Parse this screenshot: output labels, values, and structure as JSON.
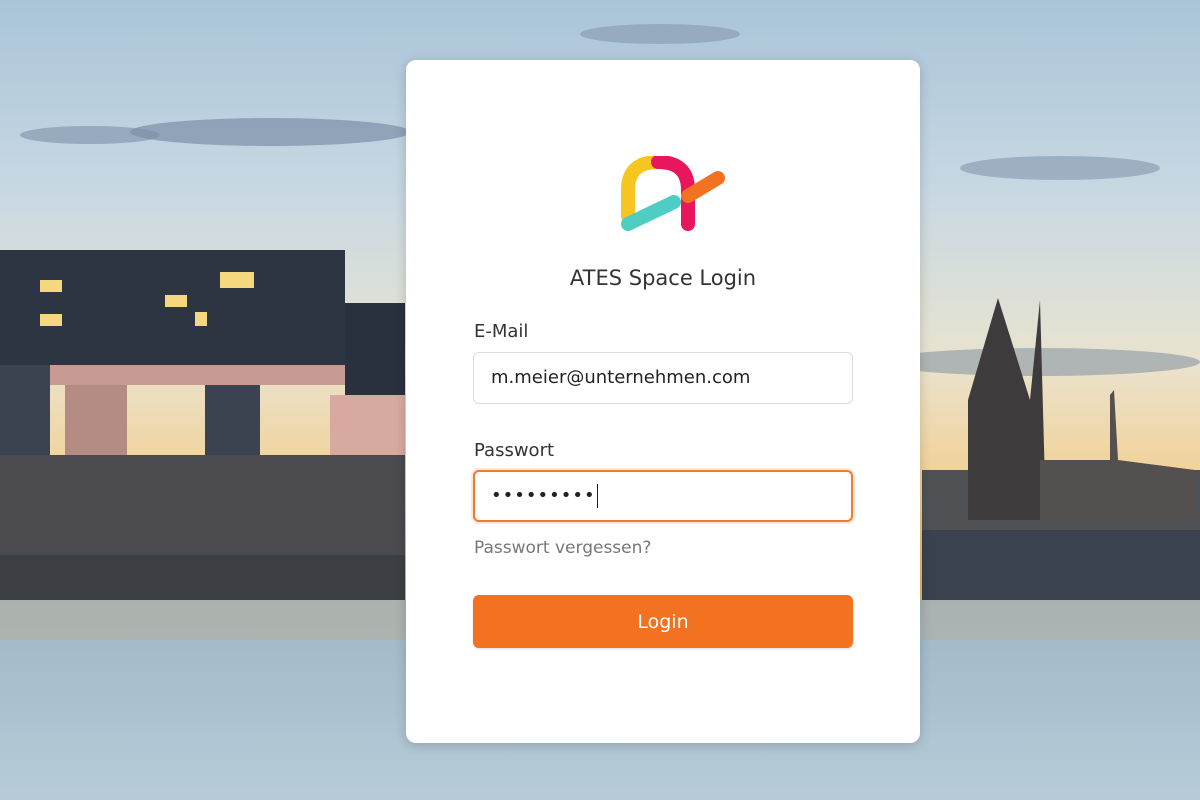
{
  "app": {
    "title": "ATES Space Login"
  },
  "form": {
    "email_label": "E-Mail",
    "email_value": "m.meier@unternehmen.com",
    "password_label": "Passwort",
    "password_masked": "•••••••••",
    "forgot_link": "Passwort vergessen?",
    "login_button": "Login"
  },
  "colors": {
    "accent": "#f37221",
    "focus_border": "#f07b2a",
    "logo_yellow": "#f7c51f",
    "logo_teal": "#4ecdc4",
    "logo_red": "#e8175d",
    "logo_orange": "#f37221"
  },
  "icons": {
    "logo": "ates-logo-icon"
  }
}
